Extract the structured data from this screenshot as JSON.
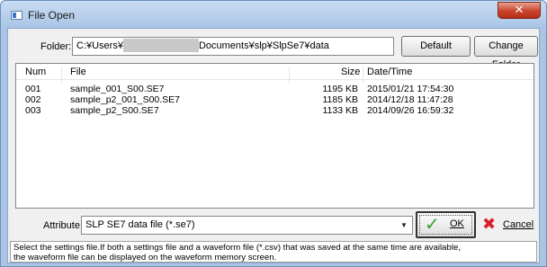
{
  "window": {
    "title": "File Open",
    "close_glyph": "✕"
  },
  "folder": {
    "label": "Folder:",
    "path_prefix": "C:¥Users¥",
    "path_suffix": "Documents¥slp¥SlpSe7¥data",
    "default_button": "Default",
    "change_button": "Change Folder"
  },
  "list": {
    "columns": {
      "num": "Num",
      "file": "File",
      "size": "Size",
      "date": "Date/Time"
    },
    "rows": [
      {
        "num": "001",
        "file": "sample_001_S00.SE7",
        "size": "1195 KB",
        "date": "2015/01/21 17:54:30"
      },
      {
        "num": "002",
        "file": "sample_p2_001_S00.SE7",
        "size": "1185 KB",
        "date": "2014/12/18 11:47:28"
      },
      {
        "num": "003",
        "file": "sample_p2_S00.SE7",
        "size": "1133 KB",
        "date": "2014/09/26 16:59:32"
      }
    ]
  },
  "attribute": {
    "label": "Attribute:",
    "selected": "SLP SE7 data file (*.se7)"
  },
  "buttons": {
    "ok": "OK",
    "cancel": "Cancel"
  },
  "help": {
    "line1": "Select the settings file.If both a settings file and a waveform file (*.csv) that was saved at the same time are available,",
    "line2": "the waveform file can be displayed on the waveform memory screen."
  },
  "colors": {
    "title_bar": "#aac4e4",
    "close_button": "#c9422b",
    "ok_check": "#2fa32f",
    "cancel_x": "#d8202a"
  },
  "icons": {
    "app": "window-icon",
    "close": "close-icon",
    "ok": "checkmark-icon",
    "cancel": "x-icon",
    "dropdown": "chevron-down-icon"
  }
}
